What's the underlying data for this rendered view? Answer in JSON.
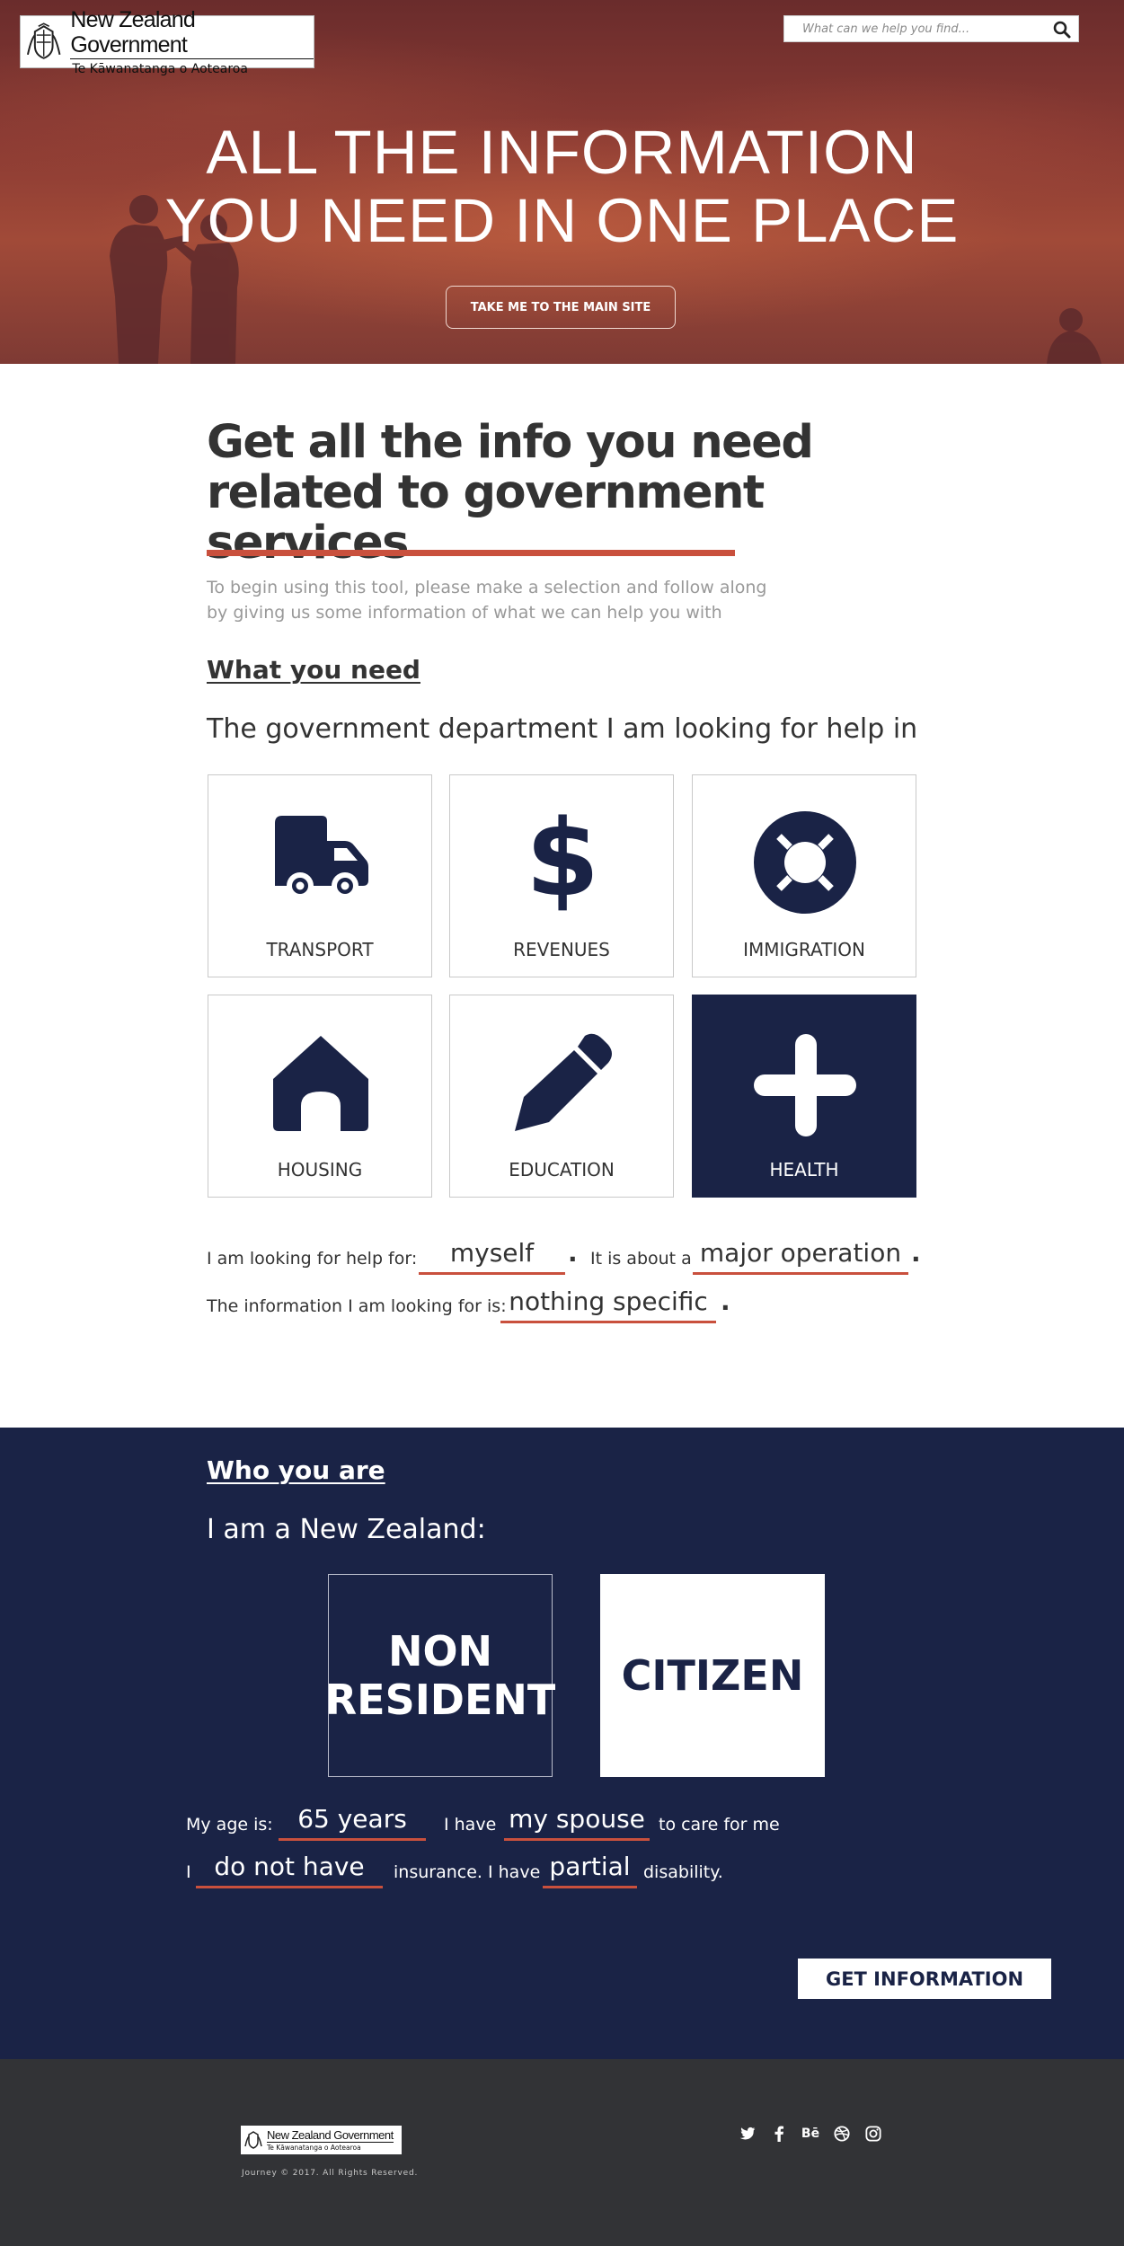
{
  "header": {
    "logo": {
      "name": "New Zealand Government",
      "maori": "Te Kāwanatanga o Aotearoa"
    },
    "search": {
      "placeholder": "What can we help you find..."
    }
  },
  "hero": {
    "title_line1": "ALL THE INFORMATION",
    "title_line2": "YOU NEED IN ONE PLACE",
    "button_label": "TAKE ME TO THE MAIN SITE"
  },
  "intro": {
    "title": "Get all the info you need related to government services",
    "text": "To begin using this tool, please make a selection and follow along by giving us some information of what we can help you with"
  },
  "need": {
    "heading": "What you need",
    "question": "The government department I am looking for help in",
    "departments": [
      {
        "label": "TRANSPORT",
        "icon": "truck-icon",
        "selected": false
      },
      {
        "label": "REVENUES",
        "icon": "dollar-icon",
        "selected": false
      },
      {
        "label": "IMMIGRATION",
        "icon": "life-ring-icon",
        "selected": false
      },
      {
        "label": "HOUSING",
        "icon": "home-icon",
        "selected": false
      },
      {
        "label": "EDUCATION",
        "icon": "pencil-icon",
        "selected": false
      },
      {
        "label": "HEALTH",
        "icon": "plus-icon",
        "selected": true
      }
    ],
    "sentence": {
      "help_for_prefix": "I am looking for help for:",
      "help_for_value": "myself",
      "about_prefix": "It is about a",
      "about_value": "major operation",
      "info_prefix": "The information I am looking for is:",
      "info_value": "nothing specific",
      "period": "."
    }
  },
  "who": {
    "heading": "Who you are",
    "question": "I am a New Zealand:",
    "options": [
      {
        "label_line1": "NON",
        "label_line2": "RESIDENT",
        "selected": false
      },
      {
        "label": "CITIZEN",
        "selected": true
      }
    ],
    "sentence": {
      "age_prefix": "My age is:",
      "age_value": "65 years",
      "have_prefix": "I have",
      "carer_value": "my spouse",
      "carer_suffix": "to care for me",
      "i_prefix": "I",
      "insurance_value": "do not have",
      "insurance_suffix": "insurance.",
      "have2_prefix": "I have",
      "disability_value": "partial",
      "disability_suffix": "disability."
    },
    "submit_label": "GET INFORMATION"
  },
  "footer": {
    "logo": {
      "name": "New Zealand Government",
      "maori": "Te Kāwanatanga o Aotearoa"
    },
    "copyright": "Journey © 2017. All Rights Reserved.",
    "social": [
      "twitter-icon",
      "facebook-icon",
      "behance-icon",
      "dribbble-icon",
      "instagram-icon"
    ],
    "behance_text": "Bē"
  },
  "colors": {
    "navy": "#1a2346",
    "accent_red": "#c9503d",
    "footer_bg": "#323336",
    "hero_red": "#8a3a33"
  }
}
